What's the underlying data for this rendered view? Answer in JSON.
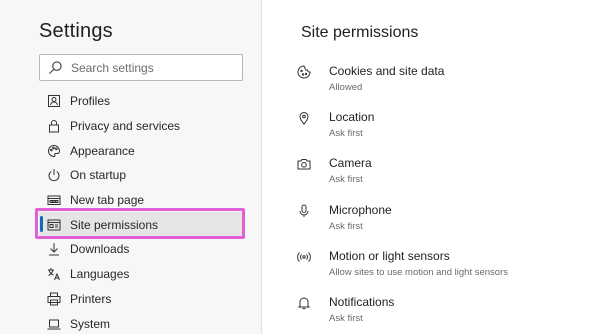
{
  "sidebar": {
    "title": "Settings",
    "search": {
      "placeholder": "Search settings",
      "value": ""
    },
    "items": [
      {
        "label": "Profiles",
        "icon": "profile-icon"
      },
      {
        "label": "Privacy and services",
        "icon": "lock-icon"
      },
      {
        "label": "Appearance",
        "icon": "palette-icon"
      },
      {
        "label": "On startup",
        "icon": "power-icon"
      },
      {
        "label": "New tab page",
        "icon": "new-tab-icon"
      },
      {
        "label": "Site permissions",
        "icon": "site-permissions-icon",
        "active": true
      },
      {
        "label": "Downloads",
        "icon": "download-icon"
      },
      {
        "label": "Languages",
        "icon": "languages-icon"
      },
      {
        "label": "Printers",
        "icon": "printer-icon"
      },
      {
        "label": "System",
        "icon": "laptop-icon"
      }
    ]
  },
  "main": {
    "title": "Site permissions",
    "permissions": [
      {
        "label": "Cookies and site data",
        "status": "Allowed",
        "icon": "cookie-icon"
      },
      {
        "label": "Location",
        "status": "Ask first",
        "icon": "location-icon"
      },
      {
        "label": "Camera",
        "status": "Ask first",
        "icon": "camera-icon"
      },
      {
        "label": "Microphone",
        "status": "Ask first",
        "icon": "microphone-icon"
      },
      {
        "label": "Motion or light sensors",
        "status": "Allow sites to use motion and light sensors",
        "icon": "sensor-icon"
      },
      {
        "label": "Notifications",
        "status": "Ask first",
        "icon": "bell-icon"
      }
    ]
  },
  "colors": {
    "accent": "#0f6cbd",
    "highlight": "#e060d8",
    "active_bg": "#e5e5e5"
  }
}
